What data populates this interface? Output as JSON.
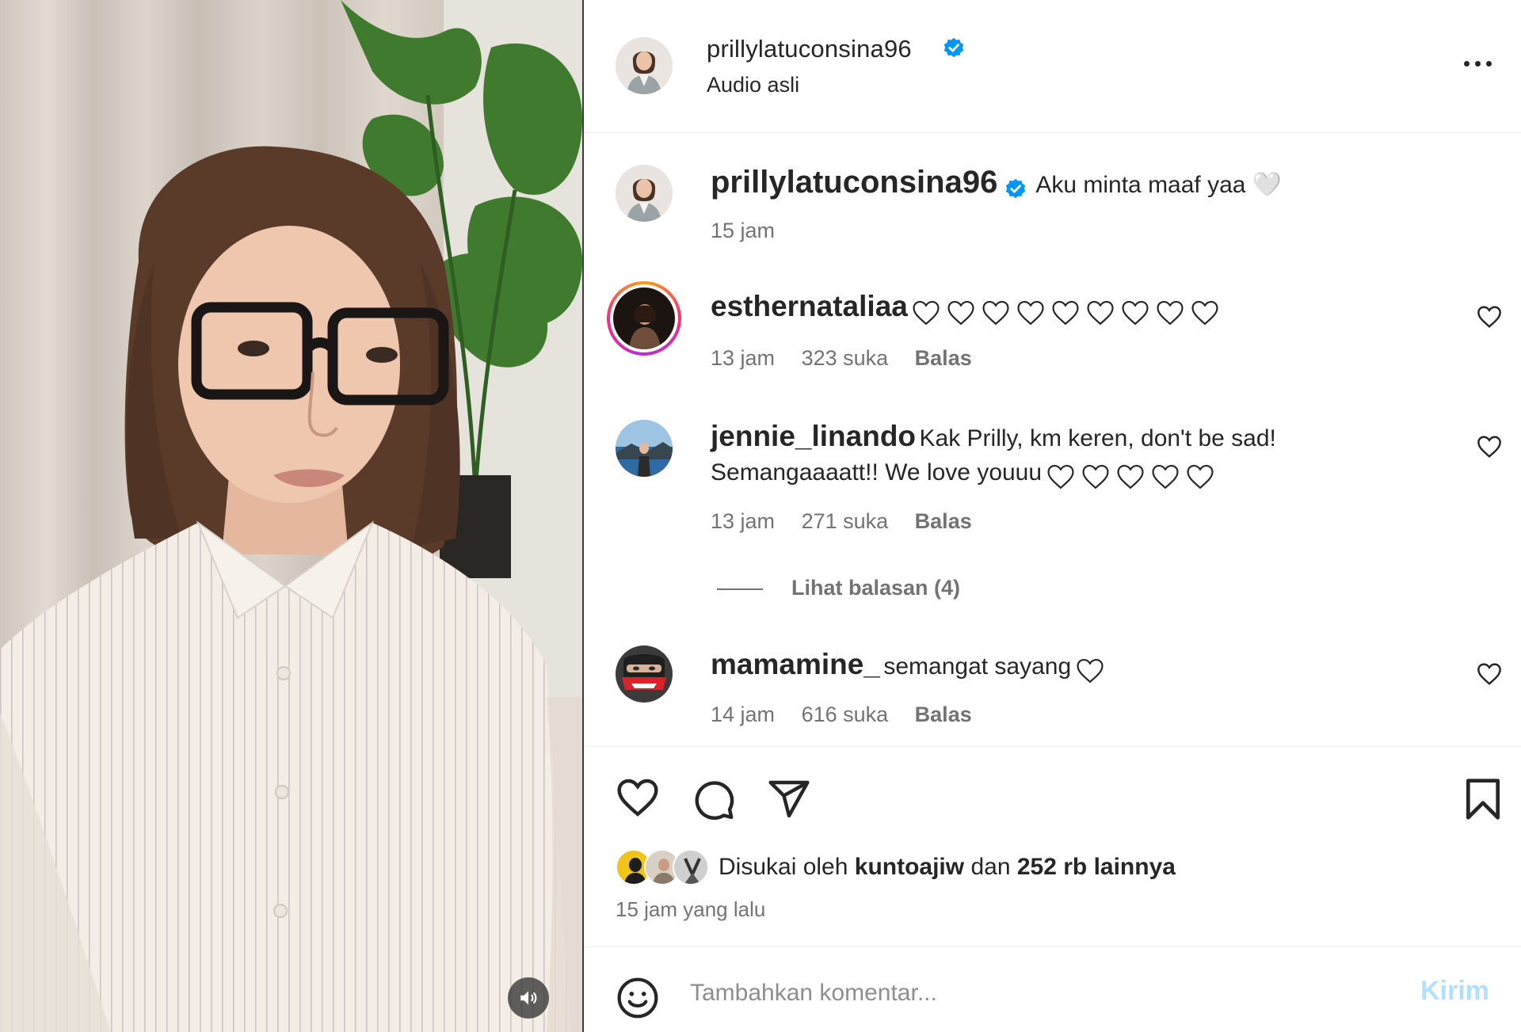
{
  "video": {
    "mute_icon": "speaker-icon"
  },
  "header": {
    "username": "prillylatuconsina96",
    "subtitle": "Audio asli",
    "verified_icon": "verified-badge-icon",
    "more_icon": "more-options-icon"
  },
  "caption": {
    "username": "prillylatuconsina96",
    "text": "Aku minta maaf yaa 🤍",
    "time": "15 jam"
  },
  "comments": [
    {
      "username": "esthernataliaa",
      "text": "",
      "hearts": 9,
      "time": "13 jam",
      "likes": "323 suka",
      "reply": "Balas"
    },
    {
      "username": "jennie_linando",
      "text": "Kak Prilly, km keren, don't be sad!",
      "text2": "Semangaaaatt!! We love youuu",
      "hearts": 5,
      "time": "13 jam",
      "likes": "271 suka",
      "reply": "Balas",
      "view_replies": "Lihat balasan (4)"
    },
    {
      "username": "mamamine_",
      "text": "semangat sayang",
      "hearts": 1,
      "time": "14 jam",
      "likes": "616 suka",
      "reply": "Balas"
    }
  ],
  "actions": {
    "like_icon": "heart-icon",
    "comment_icon": "comment-icon",
    "share_icon": "share-icon",
    "save_icon": "bookmark-icon"
  },
  "likes_summary": {
    "prefix": "Disukai oleh ",
    "liker": "kuntoajiw",
    "suffix": " dan ",
    "others": "252 rb lainnya"
  },
  "post_time": "15 jam yang lalu",
  "comment_box": {
    "placeholder": "Tambahkan komentar...",
    "post_label": "Kirim",
    "emoji_icon": "emoji-icon"
  },
  "colors": {
    "text": "#262626",
    "secondary": "#737373",
    "verified": "#0095f6",
    "post_button_disabled": "#b2dffc"
  }
}
